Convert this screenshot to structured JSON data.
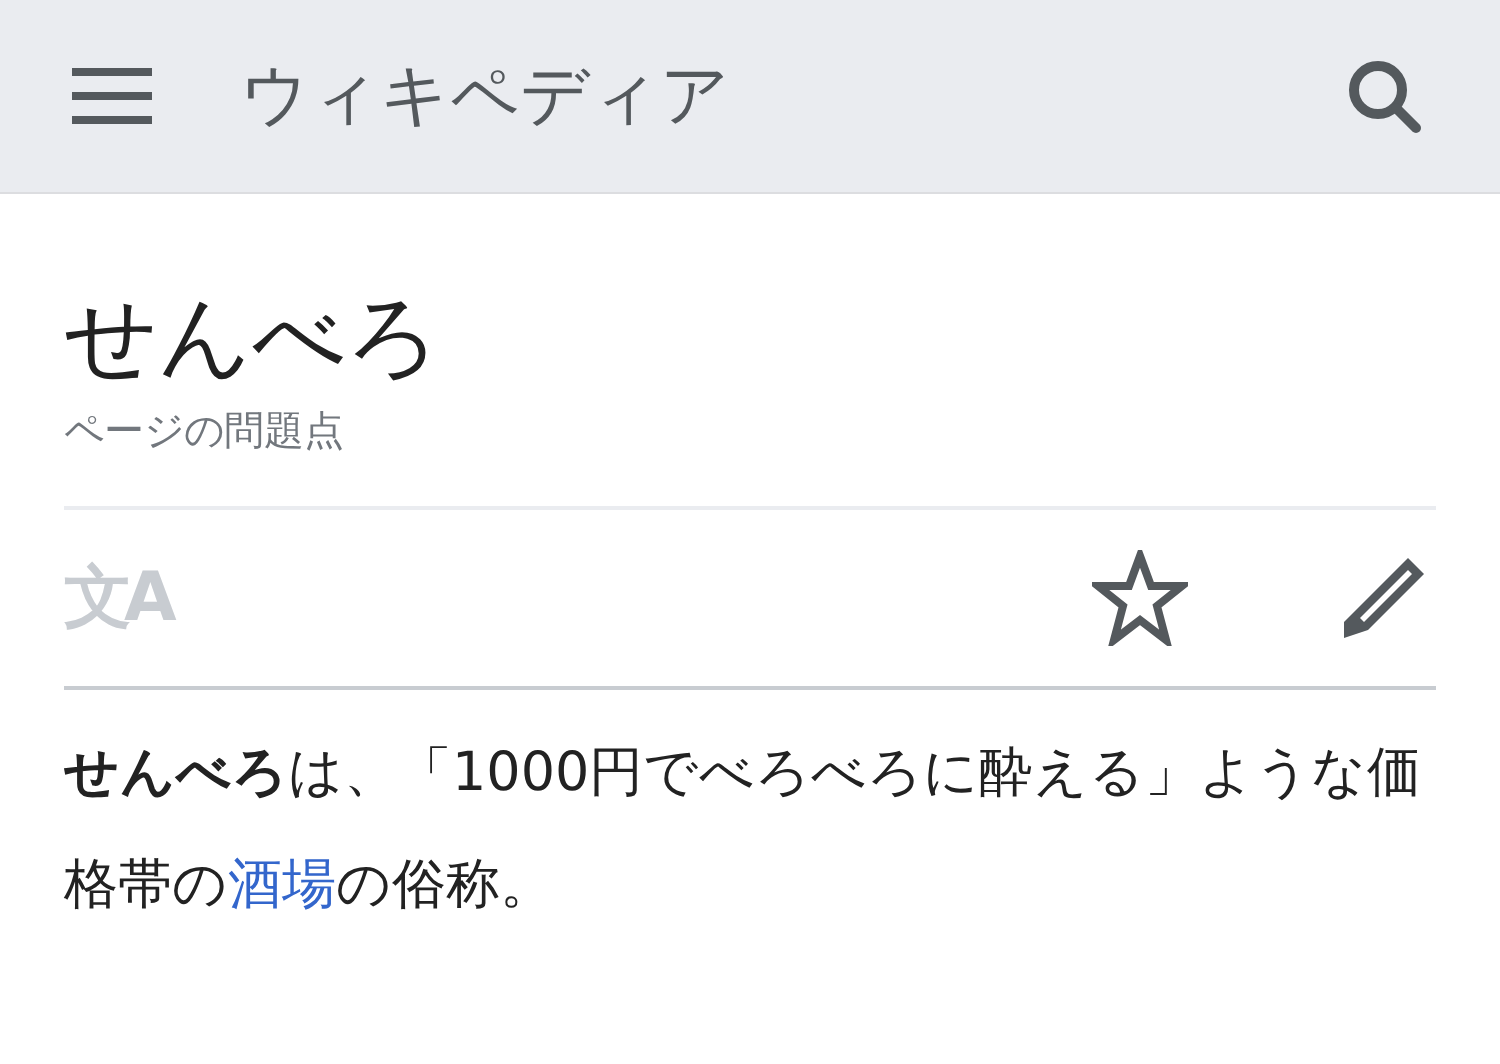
{
  "header": {
    "title": "ウィキペディア"
  },
  "article": {
    "title": "せんべろ",
    "subtitle": "ページの問題点",
    "language_icon": "文A",
    "toolbar": {
      "watched": false
    },
    "paragraph": {
      "before": "**せんべろ**は、「1000円でべろべろに酔える」ような価格帯の",
      "link": "酒場",
      "after": "の俗称。"
    }
  }
}
